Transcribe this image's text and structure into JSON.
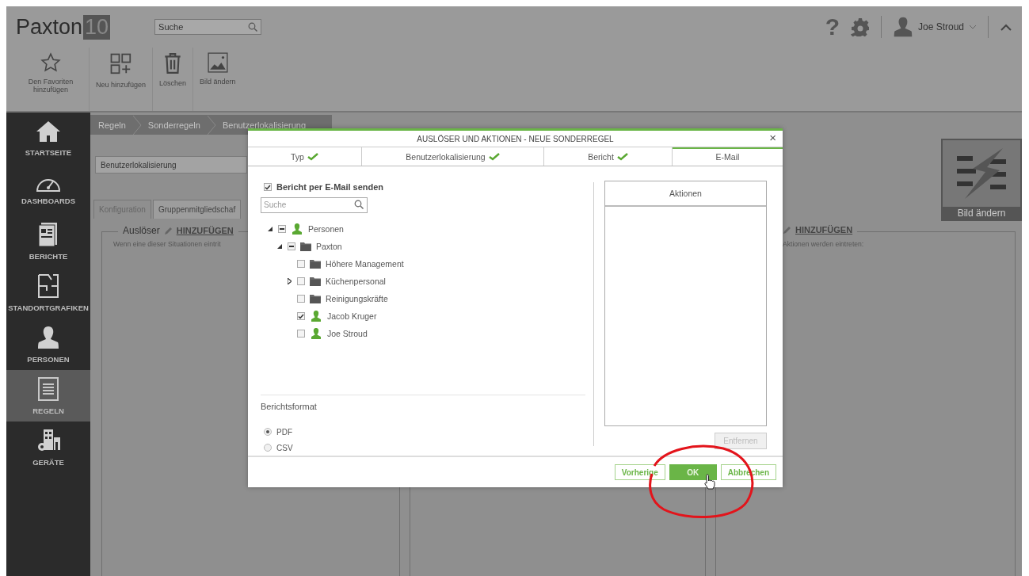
{
  "header": {
    "logo": "Paxton",
    "logo_badge": "10",
    "search": {
      "placeholder": "Suche"
    },
    "help": "?",
    "user": "Joe Stroud"
  },
  "toolbar": [
    {
      "label": "Den Favoriten hinzufügen"
    },
    {
      "label": "Neu hinzufügen"
    },
    {
      "label": "Löschen"
    },
    {
      "label": "Bild ändern"
    }
  ],
  "sidebar": {
    "items": [
      {
        "label": "STARTSEITE",
        "selected": false
      },
      {
        "label": "DASHBOARDS",
        "selected": false
      },
      {
        "label": "BERICHTE",
        "selected": false
      },
      {
        "label": "STANDORTGRAFIKEN",
        "selected": false
      },
      {
        "label": "PERSONEN",
        "selected": false
      },
      {
        "label": "REGELN",
        "selected": true
      },
      {
        "label": "GERÄTE",
        "selected": false
      }
    ]
  },
  "breadcrumbs": [
    "Regeln",
    "Sonderregeln",
    "Benutzerlokalisierung"
  ],
  "editor": {
    "name": "Benutzerlokalisierung",
    "image_label": "Bild ändern",
    "tabs": [
      {
        "label": "Konfiguration",
        "selected": true
      },
      {
        "label": "Gruppenmitgliedschaf",
        "selected": false
      }
    ],
    "triggers": {
      "title": "Auslöser",
      "add": "HINZUFÜGEN",
      "hint": "Wenn eine dieser Situationen eintrit"
    },
    "actions": {
      "add": "HINZUFÜGEN",
      "hint": "Aktionen werden eintreten:"
    }
  },
  "dialog": {
    "title": "AUSLÖSER UND AKTIONEN - NEUE SONDERREGEL",
    "close": "×",
    "steps": [
      {
        "label": "Typ",
        "done": true,
        "selected": false
      },
      {
        "label": "Benutzerlokalisierung",
        "done": true,
        "selected": false
      },
      {
        "label": "Bericht",
        "done": true,
        "selected": false
      },
      {
        "label": "E-Mail",
        "done": false,
        "selected": true
      }
    ],
    "send_email": {
      "label": "Bericht per E-Mail senden",
      "checked": true
    },
    "search": {
      "placeholder": "Suche"
    },
    "tree": [
      {
        "label": "Personen",
        "kind": "person",
        "expanded": true,
        "partial": true,
        "children": [
          {
            "label": "Paxton",
            "kind": "folder",
            "expanded": true,
            "partial": true,
            "children": [
              {
                "label": "Höhere Management",
                "kind": "folder",
                "checked": false,
                "partial": false
              },
              {
                "label": "Küchenpersonal",
                "kind": "folder",
                "expanded": false,
                "checked": false,
                "partial": false
              },
              {
                "label": "Reinigungskräfte",
                "kind": "folder",
                "checked": false,
                "partial": false
              },
              {
                "label": "Jacob Kruger",
                "kind": "person",
                "checked": true,
                "partial": false
              },
              {
                "label": "Joe Stroud",
                "kind": "person",
                "checked": false,
                "partial": false
              }
            ]
          }
        ]
      }
    ],
    "format_title": "Berichtsformat",
    "formats": [
      {
        "label": "PDF",
        "selected": true
      },
      {
        "label": "CSV",
        "selected": false
      }
    ],
    "actions_title": "Aktionen",
    "remove": {
      "label": "Entfernen",
      "disabled": true
    },
    "buttons": [
      {
        "label": "Vorherige",
        "kind": "secondary"
      },
      {
        "label": "OK",
        "kind": "primary"
      },
      {
        "label": "Abbrechen",
        "kind": "secondary"
      }
    ]
  }
}
